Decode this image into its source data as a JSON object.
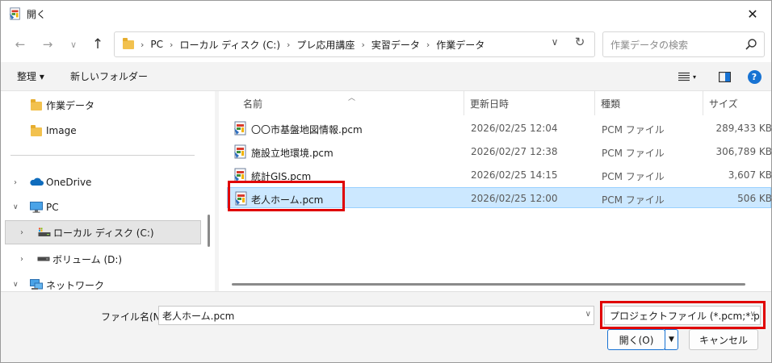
{
  "window": {
    "title": "開く"
  },
  "address": {
    "crumbs": [
      "PC",
      "ローカル ディスク (C:)",
      "プレ応用講座",
      "実習データ",
      "作業データ"
    ],
    "search_placeholder": "作業データの検索"
  },
  "toolbar": {
    "organize": "整理 ▾",
    "new_folder": "新しいフォルダー"
  },
  "nav": {
    "items": [
      {
        "label": "作業データ",
        "icon": "folder-icon"
      },
      {
        "label": "Image",
        "icon": "folder-icon"
      },
      {
        "label": "OneDrive",
        "icon": "cloud-icon"
      },
      {
        "label": "PC",
        "icon": "pc-icon"
      },
      {
        "label": "ローカル ディスク (C:)",
        "icon": "drive-icon"
      },
      {
        "label": "ボリューム (D:)",
        "icon": "drive-icon"
      },
      {
        "label": "ネットワーク",
        "icon": "network-icon"
      }
    ]
  },
  "columns": {
    "name": "名前",
    "date": "更新日時",
    "type": "種類",
    "size": "サイズ"
  },
  "files": [
    {
      "name": "〇〇市基盤地図情報.pcm",
      "date": "2026/02/25 12:04",
      "type": "PCM ファイル",
      "size": "289,433 KB"
    },
    {
      "name": "施設立地環境.pcm",
      "date": "2026/02/27 12:38",
      "type": "PCM ファイル",
      "size": "306,789 KB"
    },
    {
      "name": "統計GIS.pcm",
      "date": "2026/02/25 14:15",
      "type": "PCM ファイル",
      "size": "3,607 KB"
    },
    {
      "name": "老人ホーム.pcm",
      "date": "2026/02/25 12:00",
      "type": "PCM ファイル",
      "size": "506 KB"
    }
  ],
  "bottom": {
    "filename_label": "ファイル名(N):",
    "filename_value": "老人ホーム.pcm",
    "filter_value": "プロジェクトファイル (*.pcm;*.pcms;",
    "open_label": "開く(O)",
    "cancel_label": "キャンセル"
  },
  "colors": {
    "accent": "#1873d3",
    "highlight": "#e00000",
    "selection": "#cce8ff"
  }
}
